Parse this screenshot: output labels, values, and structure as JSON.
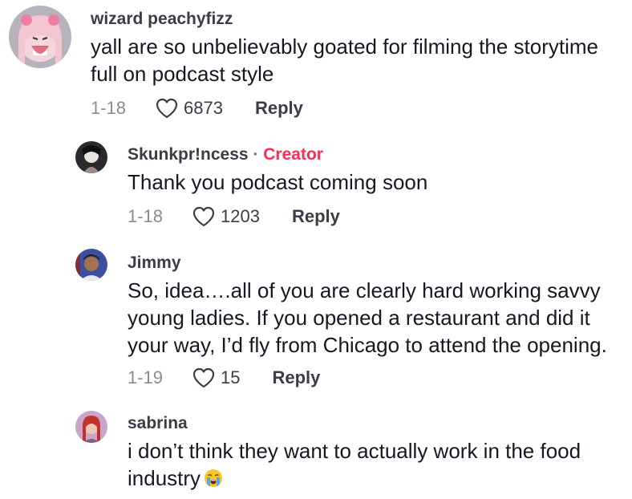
{
  "comments": [
    {
      "username": "wizard peachyfizz",
      "is_creator": false,
      "text_lines": [
        "yall are so unbelievably goated for filming the storytime",
        "full on podcast style"
      ],
      "date": "1-18",
      "likes": "6873",
      "reply_label": "Reply"
    },
    {
      "username": "Skunkpr!ncess",
      "is_creator": true,
      "creator_sep": "·",
      "creator_label": "Creator",
      "text_lines": [
        "Thank you podcast coming soon"
      ],
      "date": "1-18",
      "likes": "1203",
      "reply_label": "Reply"
    },
    {
      "username": "Jimmy",
      "is_creator": false,
      "text_lines": [
        "So, idea….all of you are clearly hard working savvy",
        "young ladies. If you opened a restaurant and did it",
        "your way, I’d fly from Chicago to attend the opening."
      ],
      "date": "1-19",
      "likes": "15",
      "reply_label": "Reply"
    },
    {
      "username": "sabrina",
      "is_creator": false,
      "text_lines": [
        "i don’t think they want to actually work in the food",
        "industry"
      ],
      "emoji": "loudly-crying-face-emoji"
    }
  ],
  "colors": {
    "creator_accent": "#fe2c55",
    "username": "#3a3c47",
    "meta_gray": "#8a8b91"
  }
}
